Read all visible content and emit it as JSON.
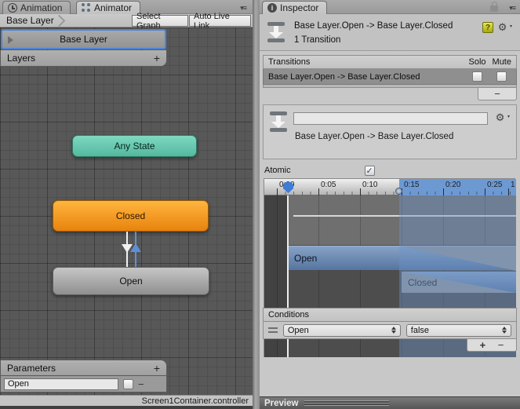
{
  "animator": {
    "tabs": {
      "animation": "Animation",
      "animator": "Animator"
    },
    "breadcrumb": "Base Layer",
    "toolbar": {
      "select_graph": "Select Graph",
      "auto_live_link": "Auto Live Link"
    },
    "layers_widget": {
      "selected_layer": "Base Layer",
      "header": "Layers",
      "add_label": "+"
    },
    "nodes": {
      "any_state": "Any State",
      "closed": "Closed",
      "open": "Open"
    },
    "parameters": {
      "header": "Parameters",
      "add_label": "+",
      "row_name": "Open",
      "remove_label": "−"
    },
    "status_bar": "Screen1Container.controller"
  },
  "inspector": {
    "tab": "Inspector",
    "header": {
      "title": "Base Layer.Open -> Base Layer.Closed",
      "subtitle": "1 Transition",
      "help_glyph": "?"
    },
    "transitions": {
      "header": "Transitions",
      "solo": "Solo",
      "mute": "Mute",
      "row_label": "Base Layer.Open -> Base Layer.Closed",
      "remove_label": "−"
    },
    "detail": {
      "name_value": "",
      "label": "Base Layer.Open -> Base Layer.Closed",
      "gear_glyph": "⚙"
    },
    "atomic": {
      "label": "Atomic",
      "check_glyph": "✓"
    },
    "timeline": {
      "ticks": [
        "0:00",
        "0:05",
        "0:10",
        "0:15",
        "0:20",
        "0:25",
        "1"
      ],
      "open_clip": "Open",
      "closed_clip": "Closed"
    },
    "conditions": {
      "header": "Conditions",
      "parameter_value": "Open",
      "compare_value": "false",
      "add_label": "+",
      "remove_label": "−"
    },
    "preview": "Preview",
    "gear_glyph": "⚙"
  }
}
